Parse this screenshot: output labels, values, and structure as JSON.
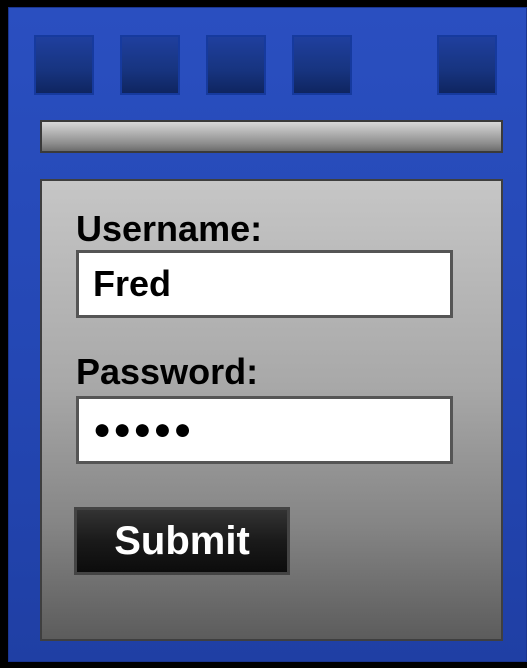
{
  "toolbar": {
    "buttons": [
      {
        "name": "toolbar-button-1"
      },
      {
        "name": "toolbar-button-2"
      },
      {
        "name": "toolbar-button-3"
      },
      {
        "name": "toolbar-button-4"
      },
      {
        "name": "toolbar-button-5"
      }
    ]
  },
  "address_bar": {
    "value": ""
  },
  "form": {
    "username_label": "Username:",
    "username_value": "Fred",
    "password_label": "Password:",
    "password_value": "●●●●●",
    "submit_label": "Submit"
  },
  "colors": {
    "window": "#2447b4",
    "toolbar_button": "#17347f",
    "content_top": "#c6c6c6",
    "content_bottom": "#5c5c5c",
    "submit_button": "#1a1a1a"
  }
}
